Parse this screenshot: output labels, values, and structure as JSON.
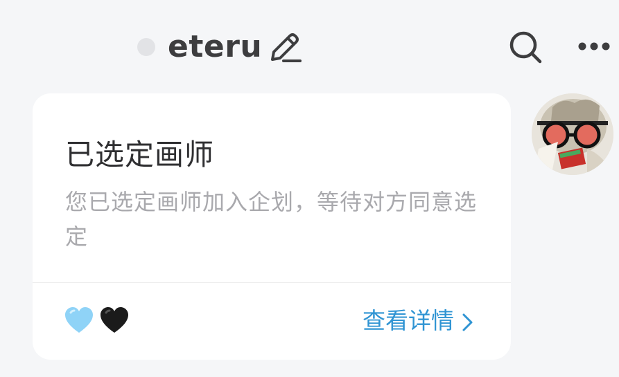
{
  "header": {
    "username": "eteru",
    "status_color": "#e2e3e6"
  },
  "icons": {
    "edit": "pencil-icon",
    "search": "search-icon",
    "more": "more-horizontal-icon"
  },
  "card": {
    "title": "已选定画师",
    "description": "您已选定画师加入企划，等待对方同意选定",
    "hearts": [
      "light-blue-heart",
      "black-heart"
    ],
    "details_label": "查看详情"
  },
  "colors": {
    "accent": "#2f94d3",
    "heart_blue": "#8fd3f7",
    "heart_black": "#1b1b1b"
  }
}
